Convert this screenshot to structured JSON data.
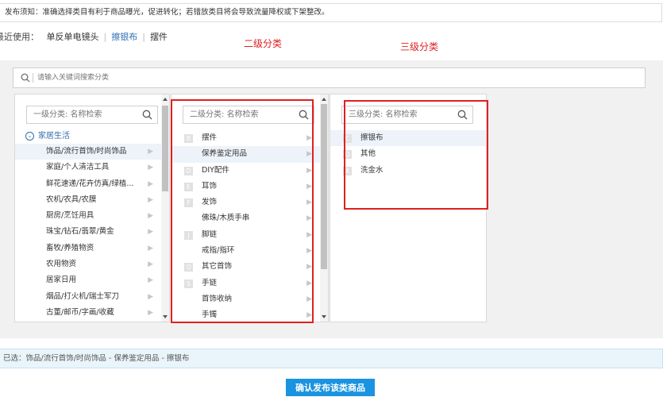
{
  "notice": {
    "text": "发布须知：准确选择类目有利于商品曝光，促进转化；若错放类目将会导致流量降权或下架整改。"
  },
  "recent": {
    "label": "最近使用：",
    "items": [
      {
        "label": "单反单电镜头"
      },
      {
        "label": "擦银布"
      },
      {
        "label": "摆件"
      }
    ]
  },
  "annotations": {
    "level2": "二级分类",
    "level3": "三级分类"
  },
  "search": {
    "placeholder": "请输入关键词搜索分类"
  },
  "level1": {
    "placeholder": "一级分类: 名称检索",
    "group": "家居生活",
    "items": [
      {
        "label": "饰品/流行首饰/时尚饰品"
      },
      {
        "label": "家庭/个人清洁工具"
      },
      {
        "label": "鲜花速递/花卉仿真/绿植..."
      },
      {
        "label": "农机/农具/农膜"
      },
      {
        "label": "厨房/烹饪用具"
      },
      {
        "label": "珠宝/钻石/翡翠/黄金"
      },
      {
        "label": "畜牧/养殖物资"
      },
      {
        "label": "农用物资"
      },
      {
        "label": "居家日用"
      },
      {
        "label": "烟品/打火机/瑞士军刀"
      },
      {
        "label": "古董/邮币/字画/收藏"
      }
    ]
  },
  "level2": {
    "placeholder": "二级分类: 名称检索",
    "items": [
      {
        "letter": "B",
        "label": "摆件"
      },
      {
        "letter": "",
        "label": "保养鉴定用品"
      },
      {
        "letter": "D",
        "label": "DIY配件"
      },
      {
        "letter": "E",
        "label": "耳饰"
      },
      {
        "letter": "F",
        "label": "发饰"
      },
      {
        "letter": "",
        "label": "佛珠/木质手串"
      },
      {
        "letter": "J",
        "label": "脚链"
      },
      {
        "letter": "",
        "label": "戒指/指环"
      },
      {
        "letter": "Q",
        "label": "其它首饰"
      },
      {
        "letter": "S",
        "label": "手链"
      },
      {
        "letter": "",
        "label": "首饰收纳"
      },
      {
        "letter": "",
        "label": "手镯"
      }
    ]
  },
  "level3": {
    "placeholder": "三级分类: 名称检索",
    "items": [
      {
        "letter": "C",
        "label": "擦银布"
      },
      {
        "letter": "Q",
        "label": "其他"
      },
      {
        "letter": "X",
        "label": "洗金水"
      }
    ]
  },
  "selected": {
    "text": "已选：饰品/流行首饰/时尚饰品 - 保养鉴定用品 - 擦银布"
  },
  "confirm": {
    "label": "确认发布该类商品"
  },
  "colors": {
    "accent": "#1a93e0",
    "link": "#2f6cb0",
    "annotation": "#e02020"
  }
}
